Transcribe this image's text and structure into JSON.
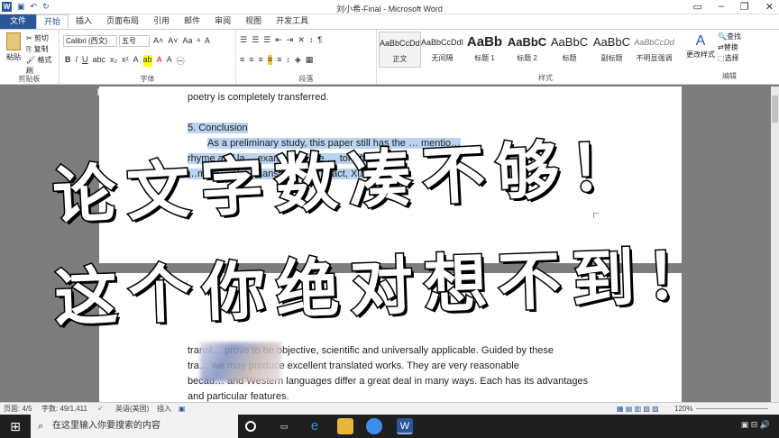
{
  "window": {
    "title": "刘小希-Final - Microsoft Word"
  },
  "tabs": [
    "文件",
    "开始",
    "插入",
    "页面布局",
    "引用",
    "邮件",
    "审阅",
    "视图",
    "开发工具"
  ],
  "ribbon": {
    "clipboard": {
      "paste": "粘贴",
      "cut": "剪切",
      "copy": "复制",
      "format_painter": "格式刷",
      "label": "剪贴板"
    },
    "font": {
      "name": "Calibri (西文)",
      "size": "五号",
      "label": "字体"
    },
    "paragraph": {
      "label": "段落"
    },
    "styles": {
      "label": "样式",
      "items": [
        {
          "preview": "AaBbCcDdI",
          "name": "正文"
        },
        {
          "preview": "AaBbCcDdI",
          "name": "无间隔"
        },
        {
          "preview": "AaBb",
          "name": "标题 1"
        },
        {
          "preview": "AaBbC",
          "name": "标题 2"
        },
        {
          "preview": "AaBbC",
          "name": "标题"
        },
        {
          "preview": "AaBbC",
          "name": "副标题"
        },
        {
          "preview": "AaBbCcDd",
          "name": "不明显强调"
        }
      ],
      "change_styles": "更改样式"
    },
    "editing": {
      "find": "查找",
      "replace": "替换",
      "select": "选择",
      "label": "编辑"
    }
  },
  "document": {
    "page1_top": "poetry is completely transferred.",
    "heading": "5. Conclusion",
    "p1_line1": "As a preliminary study, this paper still has the … mentio…",
    "p1_line2": "rhyme and la… example … the … tor aff…",
    "p1_line3": "…muni… olve… ansl… Chi… n fact, Xu",
    "p2_line1": "transl… prove to be objective, scientific and universally applicable. Guided by these",
    "p2_line2": "tra… we may produce excellent translated works. They are very reasonable",
    "p2_line3": "becau… and Western languages differ a great deal in many ways. Each has its advantages",
    "p2_line4": "and particular features."
  },
  "overlay": {
    "line1": "论文字数凑不够！",
    "line2": "这个你绝对想不到！"
  },
  "status": {
    "page": "页面: 4/5",
    "words": "字数: 49/1,411",
    "lang": "英语(美国)",
    "mode": "插入",
    "zoom": "120%"
  },
  "taskbar": {
    "search_placeholder": "在这里输入你要搜索的内容"
  }
}
